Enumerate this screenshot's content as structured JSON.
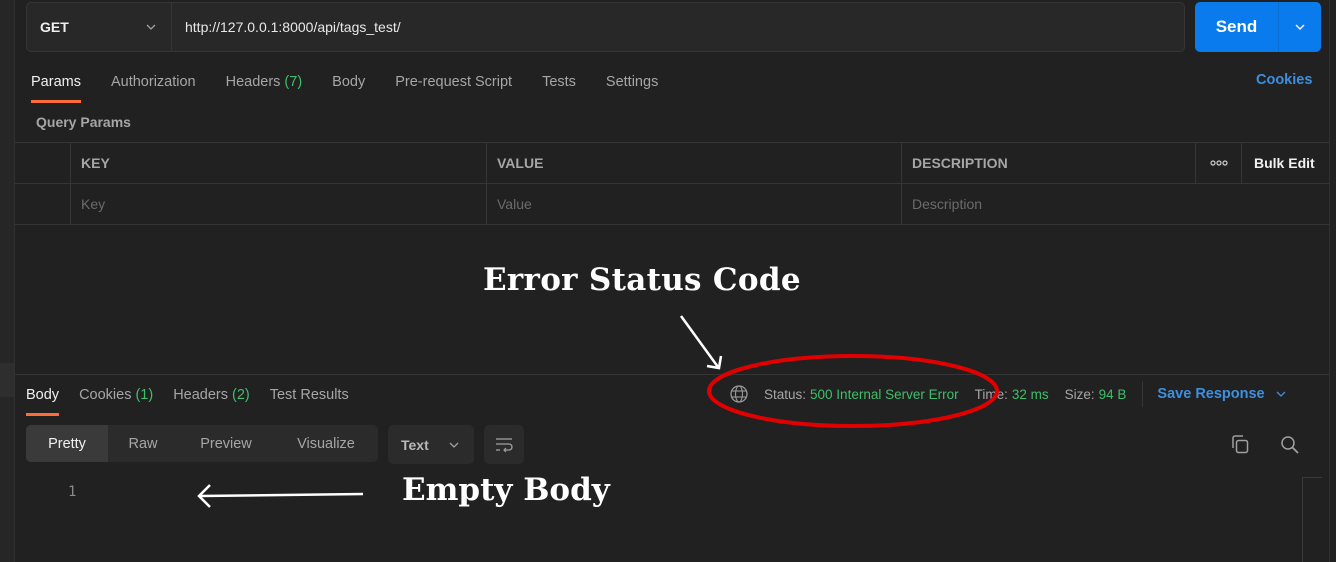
{
  "request": {
    "method": "GET",
    "url": "http://127.0.0.1:8000/api/tags_test/",
    "send_label": "Send"
  },
  "request_tabs": [
    {
      "label": "Params",
      "count": null,
      "active": true
    },
    {
      "label": "Authorization",
      "count": null,
      "active": false
    },
    {
      "label": "Headers",
      "count": "(7)",
      "active": false
    },
    {
      "label": "Body",
      "count": null,
      "active": false
    },
    {
      "label": "Pre-request Script",
      "count": null,
      "active": false
    },
    {
      "label": "Tests",
      "count": null,
      "active": false
    },
    {
      "label": "Settings",
      "count": null,
      "active": false
    }
  ],
  "cookies_link": "Cookies",
  "query_params": {
    "title": "Query Params",
    "columns": {
      "key": "KEY",
      "value": "VALUE",
      "description": "DESCRIPTION",
      "bulk_edit": "Bulk Edit"
    },
    "placeholders": {
      "key": "Key",
      "value": "Value",
      "description": "Description"
    }
  },
  "annotations": {
    "status_label": "Error Status Code",
    "body_label": "Empty Body"
  },
  "response_tabs": [
    {
      "label": "Body",
      "count": null,
      "active": true
    },
    {
      "label": "Cookies",
      "count": "(1)",
      "active": false
    },
    {
      "label": "Headers",
      "count": "(2)",
      "active": false
    },
    {
      "label": "Test Results",
      "count": null,
      "active": false
    }
  ],
  "response_meta": {
    "status_label": "Status:",
    "status_value": "500 Internal Server Error",
    "time_label": "Time:",
    "time_value": "32 ms",
    "size_label": "Size:",
    "size_value": "94 B",
    "save_response": "Save Response"
  },
  "view_modes": [
    {
      "label": "Pretty",
      "active": true
    },
    {
      "label": "Raw",
      "active": false
    },
    {
      "label": "Preview",
      "active": false
    },
    {
      "label": "Visualize",
      "active": false
    }
  ],
  "format": {
    "selected": "Text"
  },
  "editor": {
    "line_numbers": [
      "1"
    ]
  },
  "colors": {
    "accent_orange": "#ff6c37",
    "send_blue": "#097bed",
    "link_blue": "#3d8fe0",
    "success_green": "#3ebf6a",
    "annotation_red": "#e00000"
  }
}
